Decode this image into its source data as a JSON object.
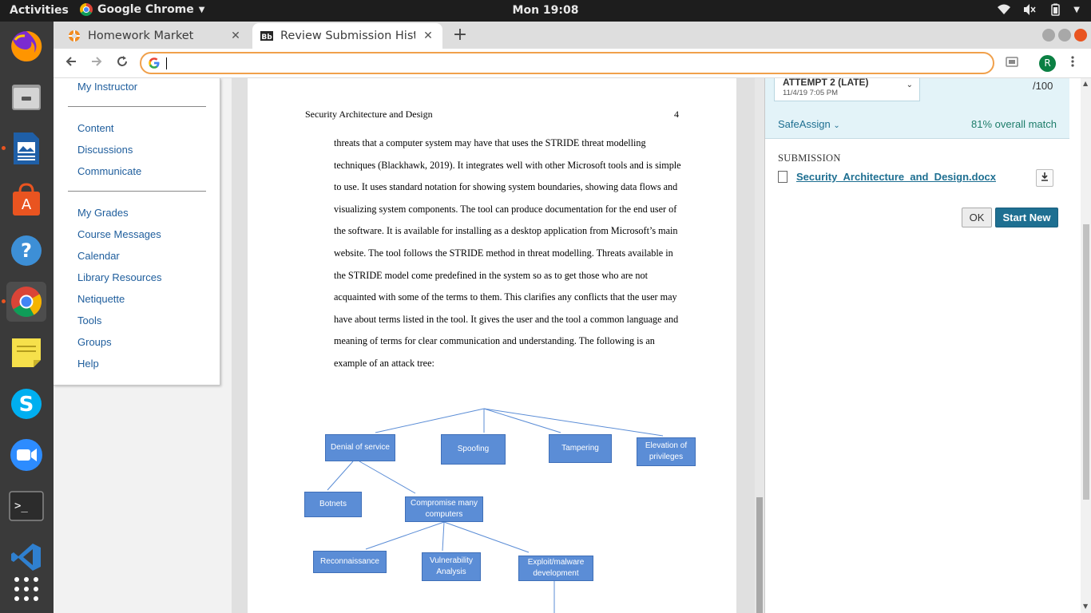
{
  "topbar": {
    "activities": "Activities",
    "app_name": "Google Chrome",
    "clock": "Mon 19:08"
  },
  "dock": {
    "items": [
      "firefox-icon",
      "files-icon",
      "writer-icon",
      "software-center-icon",
      "help-icon",
      "chrome-icon",
      "notes-icon",
      "skype-icon",
      "zoom-icon",
      "terminal-icon",
      "vscode-icon",
      "app-grid-icon"
    ]
  },
  "browser": {
    "tabs": [
      {
        "title": "Homework Market",
        "close": "✕"
      },
      {
        "title": "Review Submission Histo",
        "close": "✕"
      }
    ],
    "new_tab": "+",
    "omnibox_value": "",
    "profile_initial": "R"
  },
  "course_menu": {
    "groups": [
      [
        "My Instructor"
      ],
      [
        "Content",
        "Discussions",
        "Communicate"
      ],
      [
        "My Grades",
        "Course Messages",
        "Calendar",
        "Library Resources",
        "Netiquette",
        "Tools",
        "Groups",
        "Help"
      ]
    ]
  },
  "document": {
    "header": "Security Architecture and Design",
    "page_number": "4",
    "lines": [
      "threats that a computer system may have that uses the STRIDE threat modelling",
      "techniques (Blackhawk, 2019). It integrates well with other Microsoft tools and is simple",
      "to use. It uses standard notation for showing system boundaries, showing data flows and",
      "visualizing system components. The tool can produce documentation for the end user of",
      "the software. It is available for installing as a desktop application from Microsoft’s main",
      "website. The tool follows the STRIDE method in threat modelling. Threats available in",
      "the STRIDE model come predefined in the system so as to get those who are not",
      "acquainted with some of the terms to them. This clarifies any conflicts that the user may",
      "have about terms listed in the tool. It gives the user and the tool a common language and",
      "meaning of terms for clear communication and understanding. The following is an",
      "example of an attack tree:"
    ],
    "tree": {
      "denial": "Denial of service",
      "spoofing": "Spoofing",
      "tampering": "Tampering",
      "elevation": "Elevation of privileges",
      "botnets": "Botnets",
      "compromise": "Compromise many computers",
      "recon": "Reconnaissance",
      "vuln": "Vulnerability Analysis",
      "exploit": "Exploit/malware development"
    }
  },
  "panel": {
    "attempt_label": "ATTEMPT 2 (LATE)",
    "attempt_date": "11/4/19 7:05 PM",
    "score": "/100",
    "safeassign": "SafeAssign",
    "match": "81% overall match",
    "submission_label": "SUBMISSION",
    "file_name": "Security_Architecture_and_Design.docx",
    "ok": "OK",
    "start_new": "Start New"
  },
  "colors": {
    "accent_teal": "#1e6f91",
    "link_blue": "#1e5d9c",
    "node_blue": "#5b8dd6",
    "ubuntu_orange": "#e95420"
  }
}
